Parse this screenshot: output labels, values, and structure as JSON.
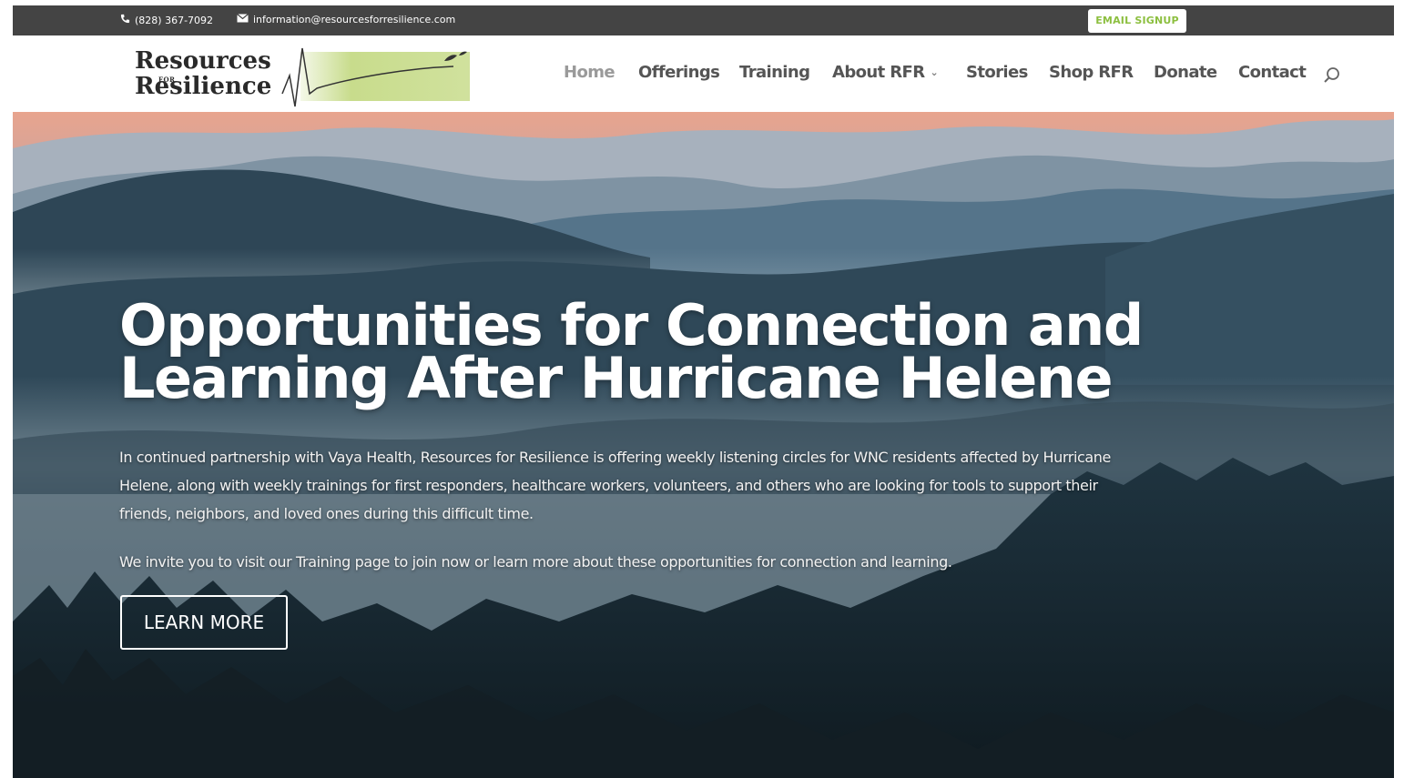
{
  "topbar": {
    "phone": "(828) 367-7092",
    "email": "information@resourcesforresilience.com",
    "signup_label": "EMAIL SIGNUP"
  },
  "logo": {
    "line1": "Resources",
    "for": "FOR",
    "line2": "Resilience"
  },
  "nav": {
    "items": [
      {
        "label": "Home"
      },
      {
        "label": "Offerings"
      },
      {
        "label": "Training"
      },
      {
        "label": "About RFR"
      },
      {
        "label": "Stories"
      },
      {
        "label": "Shop RFR"
      },
      {
        "label": "Donate"
      },
      {
        "label": "Contact"
      }
    ]
  },
  "hero": {
    "headline": "Opportunities for Connection and Learning After Hurricane Helene",
    "paragraph1": "In continued partnership with Vaya Health, Resources for Resilience is offering weekly listening circles for WNC residents affected by Hurricane Helene, along with weekly trainings for first responders, healthcare workers, volunteers, and others who are looking for tools to support their friends, neighbors, and loved ones during this difficult time.",
    "paragraph2": "We invite you to visit our Training page to join now or learn more about these opportunities for connection and learning.",
    "button_label": "LEARN MORE"
  },
  "colors": {
    "topbar_bg": "#444444",
    "signup_text": "#8cbf3f",
    "logo_green": "#c8dc8c",
    "nav_text": "#555555",
    "nav_active": "#9a9a9a"
  }
}
